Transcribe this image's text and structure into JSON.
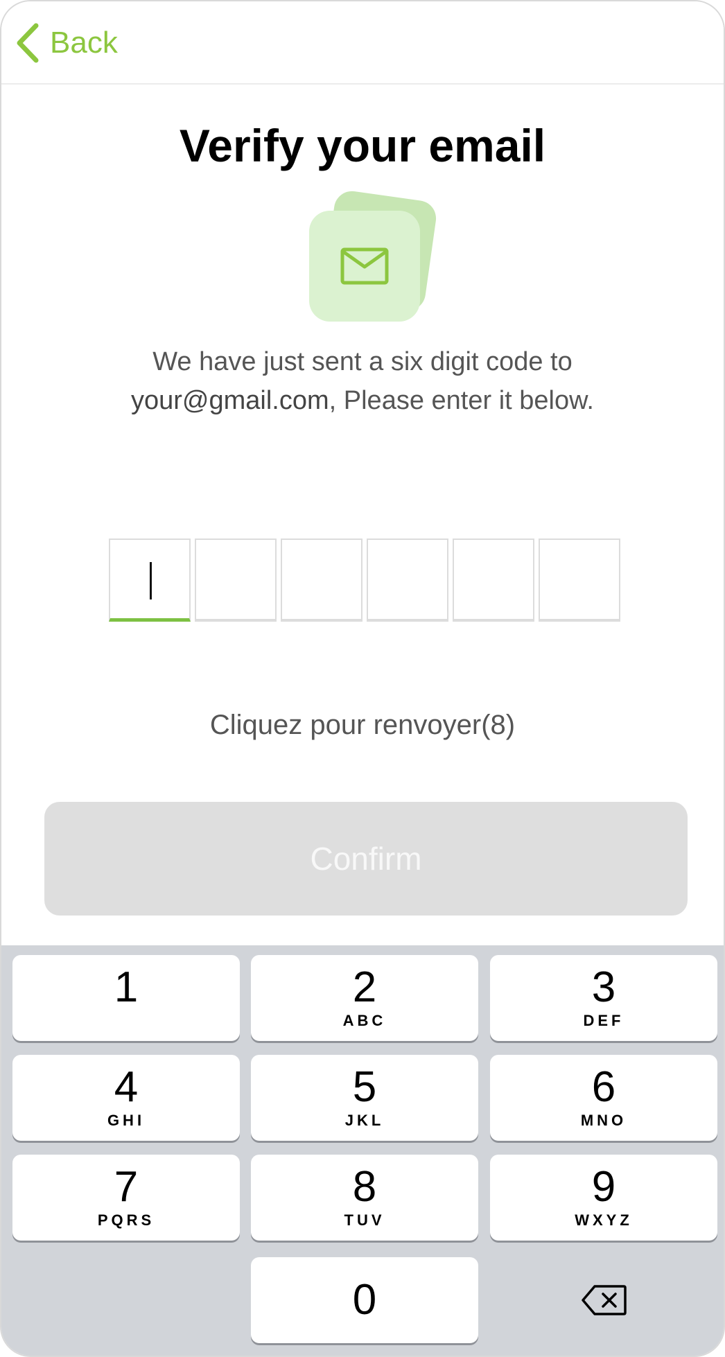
{
  "nav": {
    "back_label": "Back"
  },
  "title": "Verify your email",
  "illustration": {
    "icon": "envelope-icon"
  },
  "description": {
    "line1": "We have just sent a six digit code to",
    "email": "your@gmail.com",
    "line2_rest": ", Please enter it below."
  },
  "otp": {
    "length": 6,
    "values": [
      "",
      "",
      "",
      "",
      "",
      ""
    ],
    "active_index": 0
  },
  "resend_label": "Cliquez pour renvoyer(8)",
  "confirm_label": "Confirm",
  "keypad": {
    "keys": [
      {
        "num": "1",
        "letters": ""
      },
      {
        "num": "2",
        "letters": "ABC"
      },
      {
        "num": "3",
        "letters": "DEF"
      },
      {
        "num": "4",
        "letters": "GHI"
      },
      {
        "num": "5",
        "letters": "JKL"
      },
      {
        "num": "6",
        "letters": "MNO"
      },
      {
        "num": "7",
        "letters": "PQRS"
      },
      {
        "num": "8",
        "letters": "TUV"
      },
      {
        "num": "9",
        "letters": "WXYZ"
      },
      {
        "num": "0",
        "letters": ""
      }
    ],
    "delete_icon": "backspace-icon"
  },
  "colors": {
    "accent": "#8cc63f",
    "illustration_light": "#dbf2d0",
    "illustration_dark": "#c7e6b3",
    "button_disabled": "#dedede",
    "keyboard_bg": "#d1d4d9"
  }
}
